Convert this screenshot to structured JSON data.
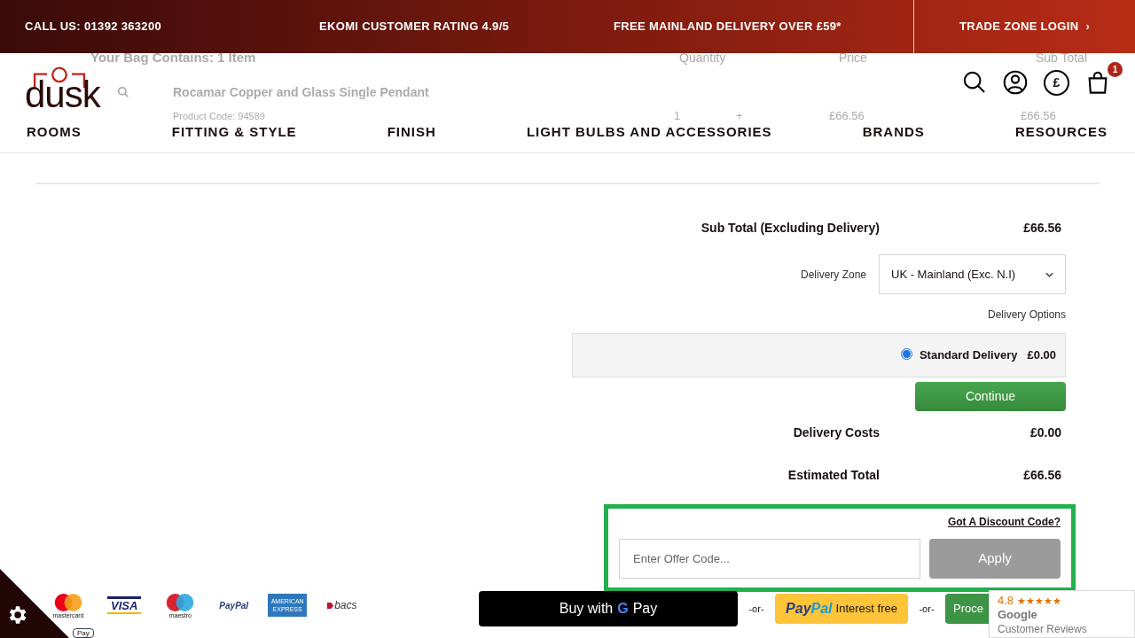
{
  "top_bar": {
    "items": [
      "CALL US: 01392 363200",
      "EKOMI CUSTOMER RATING 4.9/5",
      "FREE MAINLAND DELIVERY OVER £59*"
    ],
    "trade_login": "TRADE ZONE LOGIN",
    "trade_chevron": "›"
  },
  "header": {
    "logo": "dusk",
    "currency": "£",
    "cart_count": "1",
    "nav": [
      "ROOMS",
      "FITTING & STYLE",
      "FINISH",
      "LIGHT BULBS AND ACCESSORIES",
      "BRANDS",
      "RESOURCES"
    ]
  },
  "bag": {
    "title": "Your Bag Contains: 1 Item",
    "columns": [
      "Quantity",
      "Price",
      "Sub Total"
    ],
    "item": {
      "name": "Rocamar Copper and Glass Single Pendant",
      "code": "Product Code: 94589",
      "quantity": "1",
      "plus": "+",
      "price": "£66.56",
      "subtotal": "£66.56"
    }
  },
  "summary": {
    "subtotal_label": "Sub Total (Excluding Delivery)",
    "subtotal": "£66.56",
    "zone_label": "Delivery Zone",
    "zone_value": "UK - Mainland (Exc. N.I)",
    "options_label": "Delivery Options",
    "options": [
      {
        "label": "Standard Delivery",
        "price": "£0.00",
        "selected": true
      }
    ],
    "continue": "Continue",
    "delivery_label": "Delivery Costs",
    "delivery": "£0.00",
    "total_label": "Estimated Total",
    "total": "£66.56"
  },
  "discount": {
    "link": "Got A Discount Code?",
    "placeholder": "Enter Offer Code...",
    "apply": "Apply"
  },
  "payment_logos": [
    "mastercard",
    "VISA",
    "maestro",
    "PayPal",
    "AMERICAN EXPRESS",
    "bacs",
    "Pay"
  ],
  "checkout": {
    "gpay_prefix": "Buy with",
    "gpay_g": "G",
    "gpay_pay": "Pay",
    "or": [
      "-or-",
      "-or-"
    ],
    "paypal_brand_1": "Pay",
    "paypal_brand_2": "Pal",
    "paypal_text": "Interest free",
    "proceed": "Proce"
  },
  "reviews": {
    "rating": "4.8",
    "stars": 5,
    "brand": "Google",
    "caption": "Customer Reviews"
  }
}
